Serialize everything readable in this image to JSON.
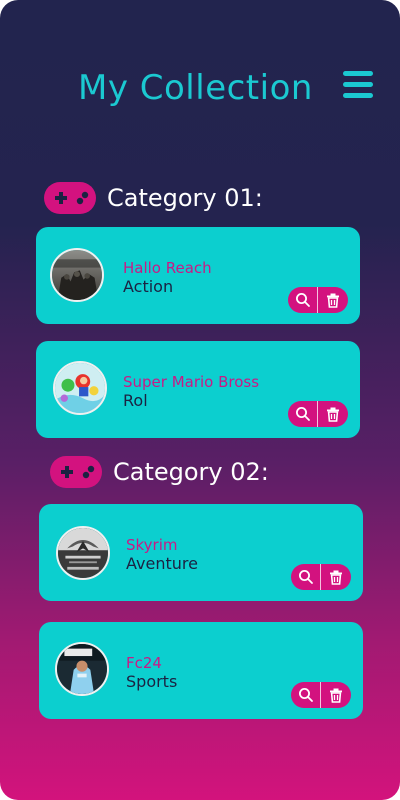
{
  "header": {
    "title": "My Collection",
    "menu_icon": "hamburger-menu-icon"
  },
  "colors": {
    "accent_cyan": "#1bc9d1",
    "card_background": "#0ccfcf",
    "accent_pink": "#d3127f",
    "game_title_color": "#c81b86",
    "genre_text_color": "#1b2242",
    "background_top": "#22244e",
    "background_bottom": "#d3137c"
  },
  "categories": [
    {
      "label": "Category 01:",
      "icon": "gamepad-icon",
      "games": [
        {
          "title": "Hallo Reach",
          "genre": "Action",
          "cover_icon": "halo-reach-cover"
        },
        {
          "title": "Super Mario Bross",
          "genre": "Rol",
          "cover_icon": "super-mario-cover"
        }
      ]
    },
    {
      "label": "Category 02:",
      "icon": "gamepad-icon",
      "games": [
        {
          "title": "Skyrim",
          "genre": "Aventure",
          "cover_icon": "skyrim-cover"
        },
        {
          "title": "Fc24",
          "genre": "Sports",
          "cover_icon": "fc24-cover"
        }
      ]
    }
  ],
  "card_actions": {
    "search_icon": "search-icon",
    "delete_icon": "trash-icon"
  }
}
